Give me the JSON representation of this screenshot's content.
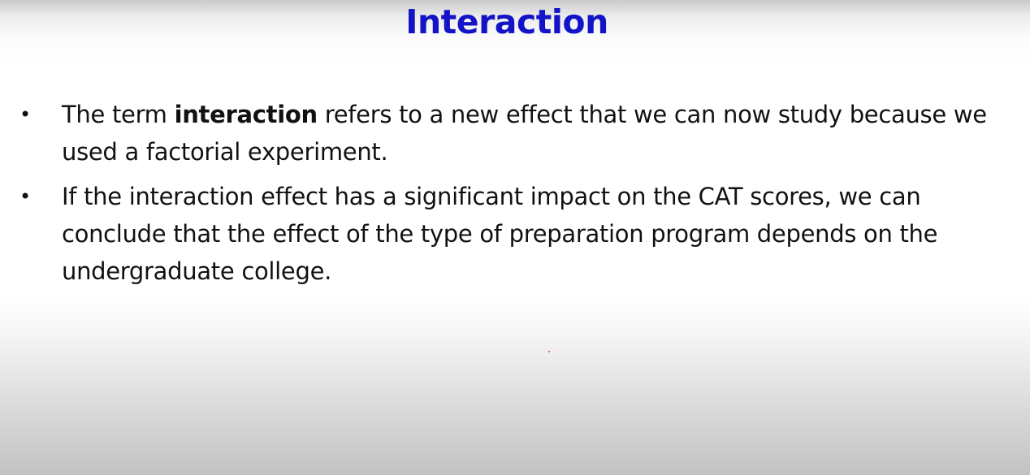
{
  "slide": {
    "title": "Interaction",
    "bullet_symbol": "•",
    "bullets": [
      {
        "prefix": "The term ",
        "bold": "interaction",
        "suffix": " refers to a new effect that we can now study because we used a factorial experiment."
      },
      {
        "text": "If the interaction effect has a significant impact on the CAT scores, we can conclude that the effect of the type of preparation program depends on the undergraduate college."
      }
    ]
  },
  "colors": {
    "title": "#1313c8",
    "body_text": "#111111",
    "pointer_dot": "#e23a3a"
  }
}
